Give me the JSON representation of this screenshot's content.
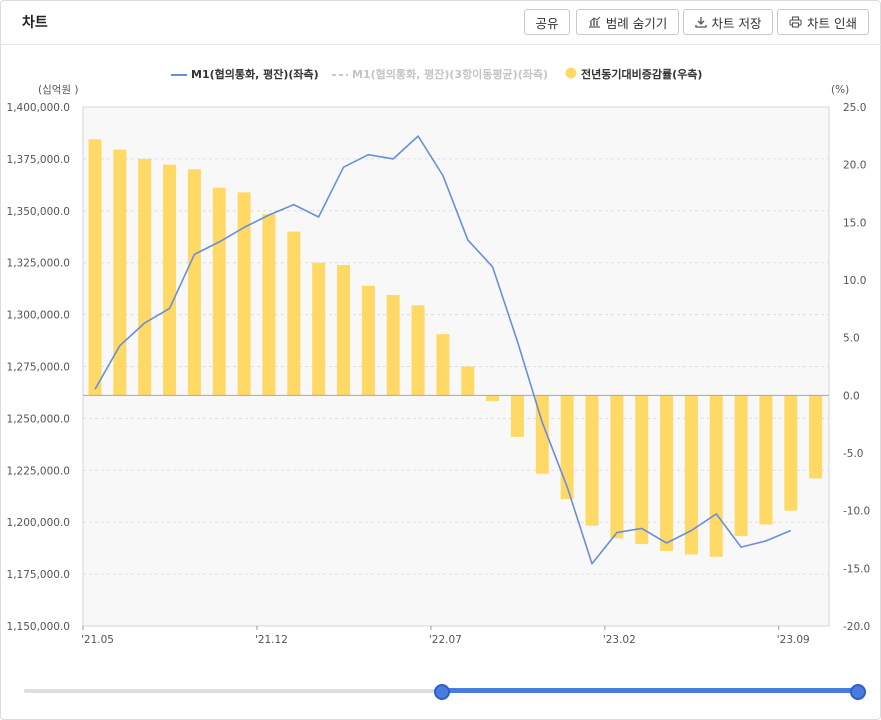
{
  "header": {
    "title": "차트",
    "share_label": "공유",
    "hide_legend_label": "범례 숨기기",
    "save_label": "차트 저장",
    "print_label": "차트 인쇄"
  },
  "legend": {
    "series1": "M1(협의통화, 평잔)(좌측)",
    "series2": "M1(협의통화, 평잔)(3항이동평균)(좌측)",
    "series3": "전년동기대비증감률(우측)"
  },
  "colors": {
    "line": "#6a8fd8",
    "bar": "#ffd966",
    "muted": "#c8c8c8",
    "slider": "#4a7be0"
  },
  "chart_data": {
    "type": "bar",
    "x_tick_labels": [
      "'21.05",
      "'21.12",
      "'22.07",
      "'23.02",
      "'23.09"
    ],
    "x": [
      "2021-05",
      "2021-06",
      "2021-07",
      "2021-08",
      "2021-09",
      "2021-10",
      "2021-11",
      "2021-12",
      "2022-01",
      "2022-02",
      "2022-03",
      "2022-04",
      "2022-05",
      "2022-06",
      "2022-07",
      "2022-08",
      "2022-09",
      "2022-10",
      "2022-11",
      "2022-12",
      "2023-01",
      "2023-02",
      "2023-03",
      "2023-04",
      "2023-05",
      "2023-06",
      "2023-07",
      "2023-08",
      "2023-09",
      "2023-10"
    ],
    "left_axis_unit": "(십억원 )",
    "right_axis_unit": "(%)",
    "left_ylim": [
      1150000,
      1400000
    ],
    "right_ylim": [
      -20,
      25
    ],
    "left_ticks": [
      "1,400,000.0",
      "1,375,000.0",
      "1,350,000.0",
      "1,325,000.0",
      "1,300,000.0",
      "1,275,000.0",
      "1,250,000.0",
      "1,225,000.0",
      "1,200,000.0",
      "1,175,000.0",
      "1,150,000.0"
    ],
    "right_ticks": [
      "25.0",
      "20.0",
      "15.0",
      "10.0",
      "5.0",
      "0.0",
      "-5.0",
      "-10.0",
      "-15.0",
      "-20.0"
    ],
    "series": [
      {
        "name": "M1(협의통화, 평잔)(좌측)",
        "type": "line",
        "axis": "left",
        "values": [
          1264000,
          1285000,
          1296000,
          1303000,
          1329000,
          1335000,
          1342000,
          1348000,
          1353000,
          1347000,
          1371000,
          1377000,
          1375000,
          1386000,
          1367000,
          1336000,
          1323000,
          1287000,
          1248000,
          1217000,
          1180000,
          1195000,
          1197000,
          1190000,
          1196000,
          1204000,
          1188000,
          1191000,
          1196000
        ]
      },
      {
        "name": "M1(협의통화, 평잔)(3항이동평균)(좌측)",
        "type": "line",
        "axis": "left",
        "hidden": true,
        "values": []
      },
      {
        "name": "전년동기대비증감률(우측)",
        "type": "bar",
        "axis": "right",
        "values": [
          22.2,
          21.3,
          20.5,
          20.0,
          19.6,
          18.0,
          17.6,
          15.7,
          14.2,
          11.5,
          11.3,
          9.5,
          8.7,
          7.8,
          5.3,
          2.5,
          -0.5,
          -3.6,
          -6.8,
          -9.0,
          -11.3,
          -12.4,
          -12.9,
          -13.5,
          -13.8,
          -14.0,
          -12.2,
          -11.2,
          -10.0,
          -7.2
        ]
      }
    ]
  }
}
